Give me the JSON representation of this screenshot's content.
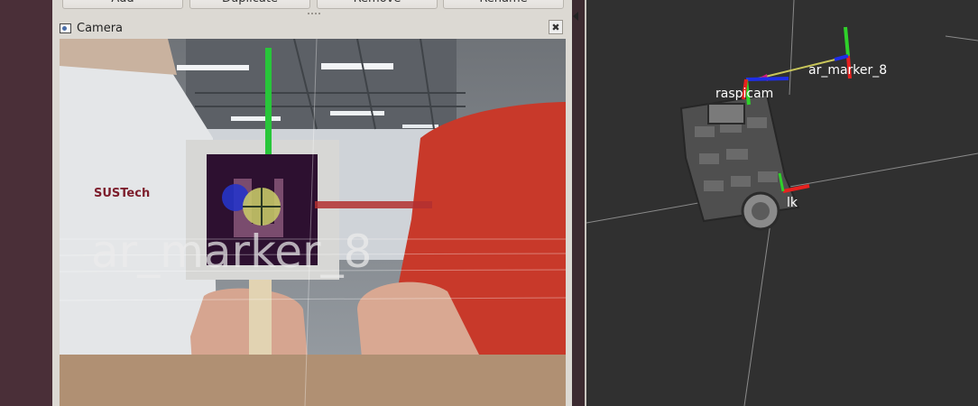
{
  "toolbar": {
    "buttons": [
      {
        "label": "Add"
      },
      {
        "label": "Duplicate"
      },
      {
        "label": "Remove"
      },
      {
        "label": "Rename"
      }
    ]
  },
  "camera_panel": {
    "title": "Camera",
    "close_glyph": "✖",
    "overlay_label": "ar_marker_8",
    "shirt_logo": "SUSTech"
  },
  "viewport_3d": {
    "frames": [
      {
        "label": "ar_marker_8"
      },
      {
        "label": "raspicam"
      },
      {
        "label": "base_link",
        "visible_text": "lk"
      }
    ],
    "background_color": "#303030",
    "axis_colors": {
      "x": "#e8211f",
      "y": "#2fd12a",
      "z": "#1f2ee6"
    }
  }
}
